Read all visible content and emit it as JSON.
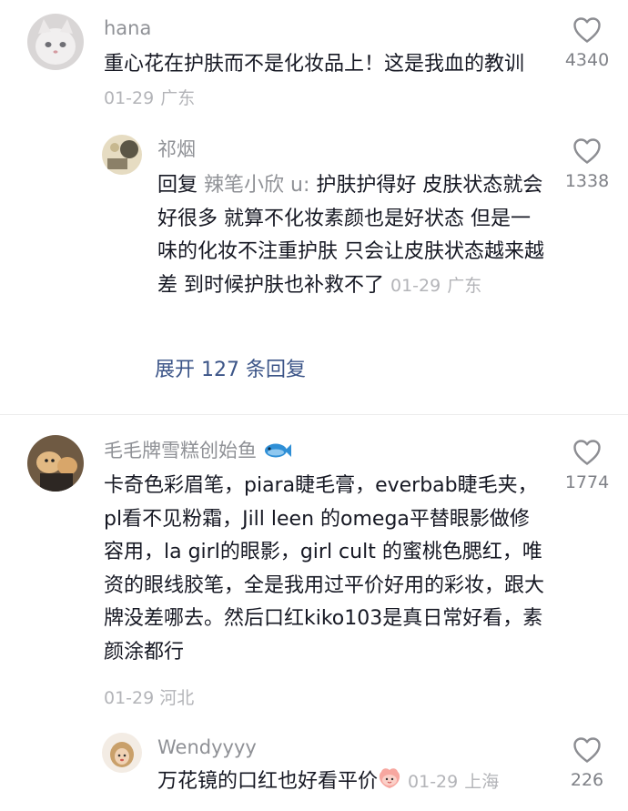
{
  "comments": [
    {
      "user": "hana",
      "text": "重心花在护肤而不是化妆品上！这是我血的教训",
      "date": "01-29",
      "location": "广东",
      "likes": "4340",
      "replies": [
        {
          "user": "祁烟",
          "prefix": "回复",
          "mention": "辣笔小欣 u:",
          "text": " 护肤护得好 皮肤状态就会好很多 就算不化妆素颜也是好状态 但是一味的化妆不注重护肤 只会让皮肤状态越来越差 到时候护肤也补救不了",
          "date": "01-29",
          "location": "广东",
          "likes": "1338"
        }
      ],
      "expand_label": "展开 127 条回复"
    },
    {
      "user": "毛毛牌雪糕创始鱼",
      "text": "卡奇色彩眉笔，piara睫毛膏，everbab睫毛夹，pl看不见粉霜，Jill leen 的omega平替眼影做修容用，la girl的眼影，girl cult 的蜜桃色腮红，唯资的眼线胶笔，全是我用过平价好用的彩妆，跟大牌没差哪去。然后口红kiko103是真日常好看，素颜涂都行",
      "date": "01-29",
      "location": "河北",
      "likes": "1774",
      "replies": [
        {
          "user": "Wendyyyy",
          "text": "万花镜的口红也好看平价",
          "date": "01-29",
          "location": "上海",
          "likes": "226"
        }
      ]
    }
  ],
  "icons": {
    "like": "heart-outline-icon",
    "fish": "fish-emoji-icon",
    "peach": "peach-face-emoji-icon"
  },
  "colors": {
    "username": "#8f9196",
    "meta": "#b3b4b8",
    "link": "#3c5588",
    "text": "#161823"
  }
}
